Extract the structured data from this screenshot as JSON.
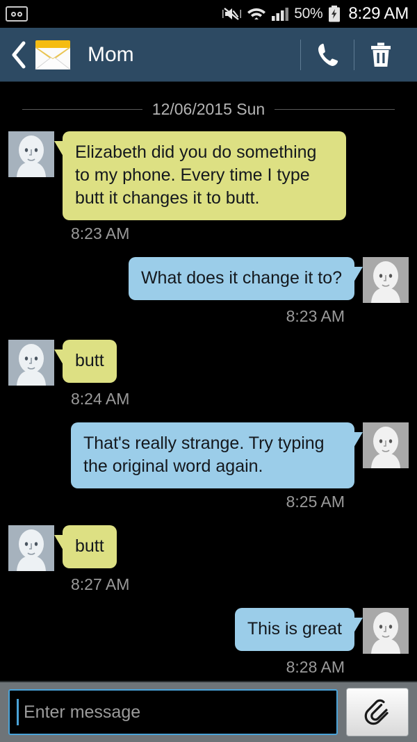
{
  "status_bar": {
    "voicemail_icon": "voicemail-icon",
    "mute_icon": "mute-vibrate-icon",
    "wifi_icon": "wifi-icon",
    "signal_icon": "cellular-signal-icon",
    "battery_percent": "50%",
    "battery_icon": "battery-charging-icon",
    "time": "8:29 AM"
  },
  "header": {
    "back_icon": "back-chevron-icon",
    "app_icon": "envelope-icon",
    "title": "Mom",
    "call_icon": "phone-icon",
    "delete_icon": "trash-icon"
  },
  "thread": {
    "date_separator": "12/06/2015 Sun",
    "messages": [
      {
        "direction": "in",
        "text": "Elizabeth did you do something to my phone. Every time I type butt it changes it to butt.",
        "time": "8:23 AM"
      },
      {
        "direction": "out",
        "text": "What does it change it to?",
        "time": "8:23 AM"
      },
      {
        "direction": "in",
        "text": "butt",
        "time": "8:24 AM"
      },
      {
        "direction": "out",
        "text": "That's really strange. Try typing the original word again.",
        "time": "8:25 AM"
      },
      {
        "direction": "in",
        "text": "butt",
        "time": "8:27 AM"
      },
      {
        "direction": "out",
        "text": "This is great",
        "time": "8:28 AM"
      }
    ]
  },
  "composer": {
    "input_value": "",
    "placeholder": "Enter message",
    "attach_icon": "paperclip-icon"
  },
  "colors": {
    "header_bg": "#2d4a63",
    "incoming_bubble": "#dde083",
    "outgoing_bubble": "#9bcde9",
    "thread_bg": "#000000",
    "composer_bg": "#6e7478",
    "input_border": "#4aa3d8",
    "timestamp": "#9a9a9a",
    "envelope_flap": "#f5bc12"
  }
}
